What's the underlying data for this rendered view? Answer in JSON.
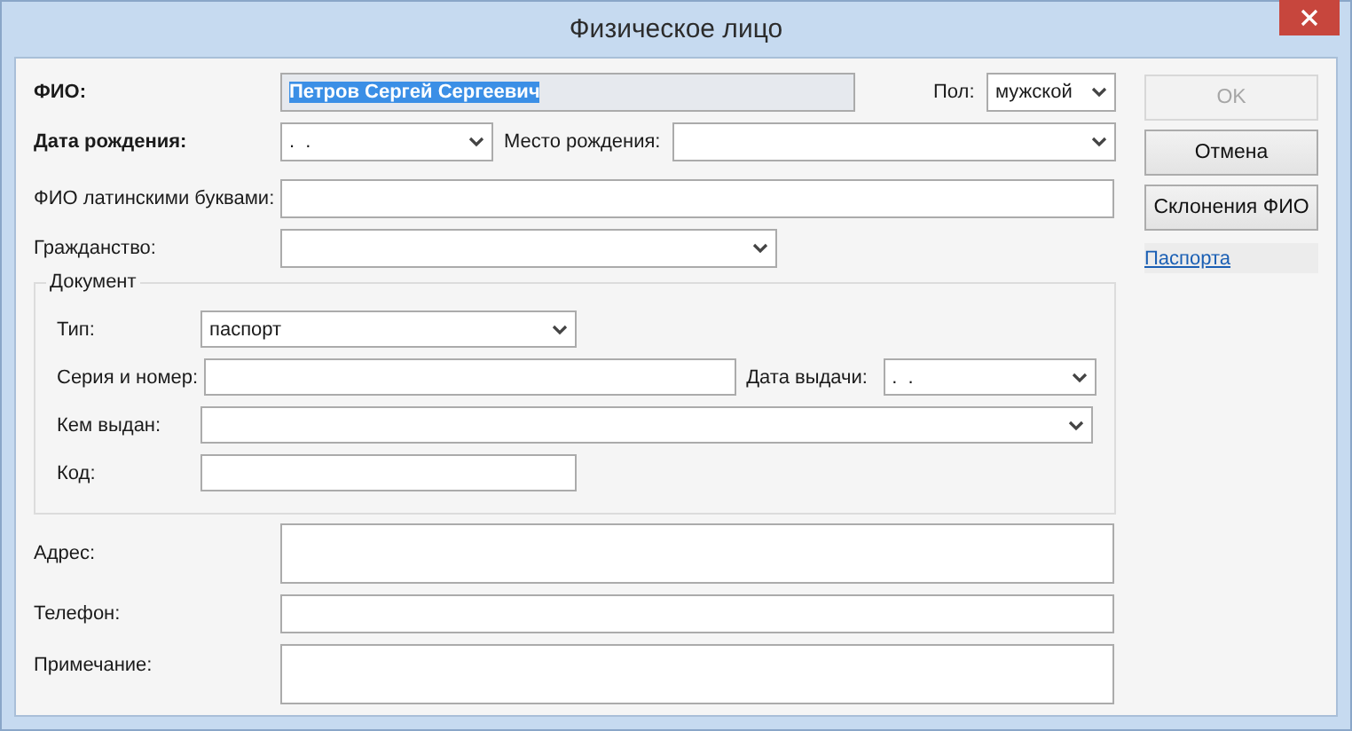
{
  "window": {
    "title": "Физическое лицо"
  },
  "person": {
    "full_name": {
      "label": "ФИО:",
      "required": true,
      "kind": "text",
      "value": "Петров Сергей Сергеевич",
      "selected": true
    },
    "gender": {
      "label": "Пол:",
      "kind": "select",
      "value": "мужской"
    },
    "birth_date": {
      "label": "Дата рождения:",
      "required": true,
      "kind": "select",
      "value": ".  ."
    },
    "birth_place": {
      "label": "Место рождения:",
      "kind": "select"
    },
    "latin_name": {
      "label": "ФИО латинскими буквами:",
      "required": false,
      "kind": "text"
    },
    "citizenship": {
      "label": "Гражданство:",
      "required": false,
      "kind": "select"
    }
  },
  "document": {
    "title": "Документ",
    "type": {
      "label": "Тип:",
      "kind": "select",
      "value": "паспорт"
    },
    "number": {
      "label": "Серия и номер:",
      "kind": "text"
    },
    "issue_date": {
      "label": "Дата выдачи:",
      "kind": "select",
      "value": ".  ."
    },
    "issued_by": {
      "label": "Кем выдан:",
      "kind": "select"
    },
    "code": {
      "label": "Код:",
      "kind": "text"
    }
  },
  "contacts": {
    "address": {
      "label": "Адрес:",
      "kind": "area"
    },
    "phone": {
      "label": "Телефон:",
      "kind": "text"
    },
    "note": {
      "label": "Примечание:",
      "kind": "area"
    }
  },
  "buttons": [
    {
      "label": "OK",
      "disabled": true
    },
    {
      "label": "Отмена",
      "disabled": false
    },
    {
      "label": "Склонения ФИО",
      "disabled": false
    }
  ],
  "link": {
    "label": "Паспорта"
  }
}
